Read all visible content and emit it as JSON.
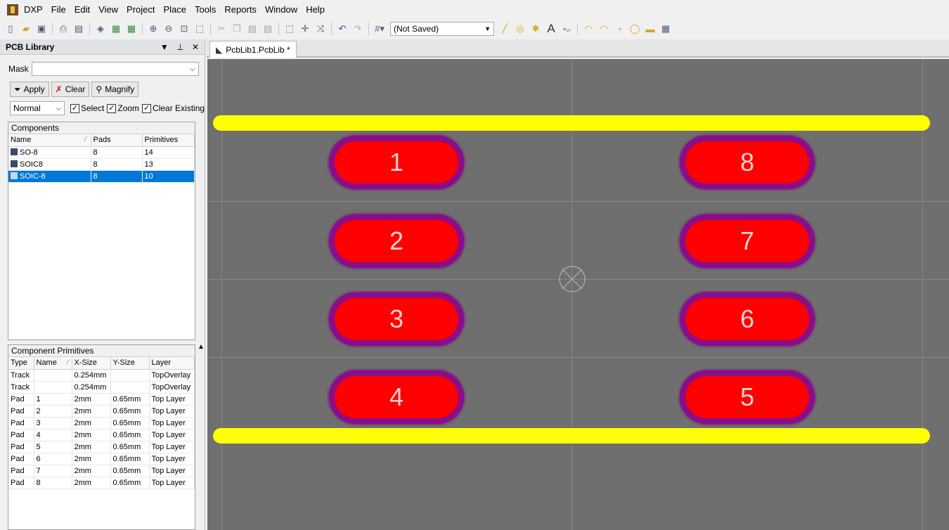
{
  "menubar": {
    "items": [
      "DXP",
      "File",
      "Edit",
      "View",
      "Project",
      "Place",
      "Tools",
      "Reports",
      "Window",
      "Help"
    ]
  },
  "toolbar": {
    "combo_value": "(Not Saved)"
  },
  "panel": {
    "title": "PCB Library",
    "mask_label": "Mask",
    "mask_value": "",
    "apply": "Apply",
    "clear": "Clear",
    "magnify": "Magnify",
    "mode": "Normal",
    "select": "Select",
    "zoom": "Zoom",
    "clear_existing": "Clear Existing"
  },
  "components": {
    "title": "Components",
    "headers": [
      "Name",
      "Pads",
      "Primitives"
    ],
    "rows": [
      {
        "name": "SO-8",
        "pads": "8",
        "primitives": "14"
      },
      {
        "name": "SOIC8",
        "pads": "8",
        "primitives": "13"
      },
      {
        "name": "SOIC-8",
        "pads": "8",
        "primitives": "10"
      }
    ],
    "selected_index": 2
  },
  "primitives": {
    "title": "Component Primitives",
    "headers": [
      "Type",
      "Name",
      "X-Size",
      "Y-Size",
      "Layer"
    ],
    "rows": [
      [
        "Track",
        "",
        "0.254mm",
        "",
        "TopOverlay"
      ],
      [
        "Track",
        "",
        "0.254mm",
        "",
        "TopOverlay"
      ],
      [
        "Pad",
        "1",
        "2mm",
        "0.65mm",
        "Top Layer"
      ],
      [
        "Pad",
        "2",
        "2mm",
        "0.65mm",
        "Top Layer"
      ],
      [
        "Pad",
        "3",
        "2mm",
        "0.65mm",
        "Top Layer"
      ],
      [
        "Pad",
        "4",
        "2mm",
        "0.65mm",
        "Top Layer"
      ],
      [
        "Pad",
        "5",
        "2mm",
        "0.65mm",
        "Top Layer"
      ],
      [
        "Pad",
        "6",
        "2mm",
        "0.65mm",
        "Top Layer"
      ],
      [
        "Pad",
        "7",
        "2mm",
        "0.65mm",
        "Top Layer"
      ],
      [
        "Pad",
        "8",
        "2mm",
        "0.65mm",
        "Top Layer"
      ]
    ]
  },
  "document_tab": "PcbLib1.PcbLib *",
  "pads": [
    {
      "label": "1"
    },
    {
      "label": "2"
    },
    {
      "label": "3"
    },
    {
      "label": "4"
    },
    {
      "label": "5"
    },
    {
      "label": "6"
    },
    {
      "label": "7"
    },
    {
      "label": "8"
    }
  ],
  "colors": {
    "pad_copper": "#ff0000",
    "solder_mask": "#8a0d8a",
    "top_overlay": "#ffff00",
    "canvas": "#6f6f6f",
    "selection": "#0078d7"
  }
}
